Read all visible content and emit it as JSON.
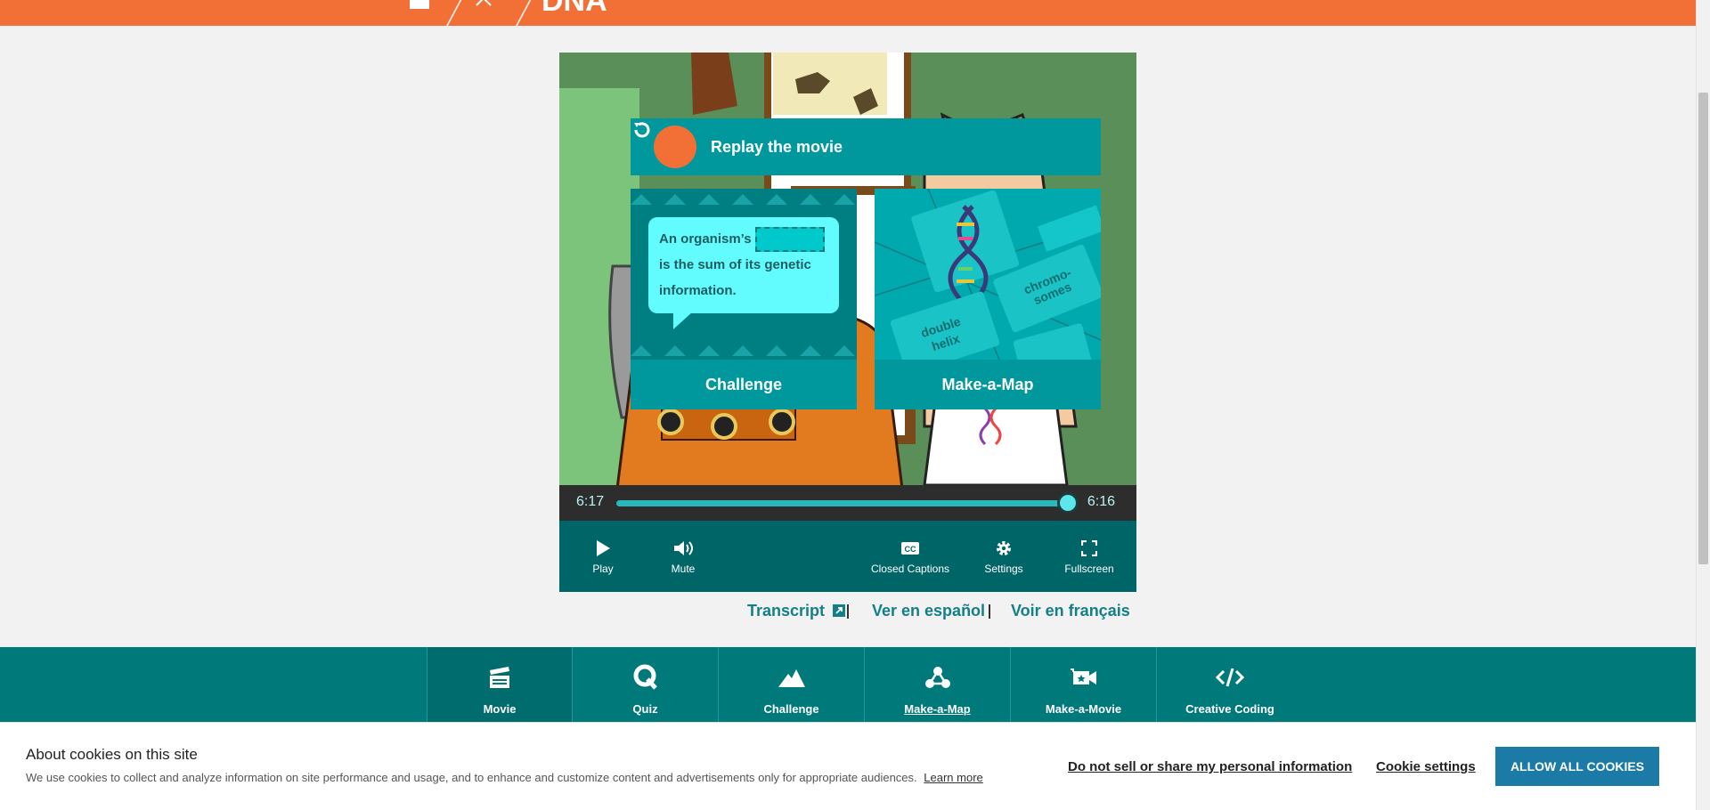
{
  "header": {
    "title": "DNA",
    "bg_color": "#f26f36"
  },
  "player": {
    "replay_label": "Replay the movie",
    "challenge_card": {
      "label": "Challenge",
      "bubble_prefix": "An organism’s",
      "bubble_suffix": "is the sum of its genetic information."
    },
    "map_card": {
      "label": "Make-a-Map",
      "tile_1": "chromo-somes",
      "tile_2": "double helix"
    },
    "time_elapsed": "6:17",
    "time_total": "6:16",
    "progress_percent": 100,
    "controls": [
      {
        "label": "Play",
        "icon": "play-icon"
      },
      {
        "label": "Mute",
        "icon": "volume-icon"
      },
      {
        "label": "Closed Captions",
        "icon": "cc-icon"
      },
      {
        "label": "Settings",
        "icon": "gear-icon"
      },
      {
        "label": "Fullscreen",
        "icon": "fullscreen-icon"
      }
    ]
  },
  "links": {
    "transcript": "Transcript",
    "spanish": "Ver en español",
    "french": "Voir en français"
  },
  "toolnav": {
    "items": [
      {
        "label": "Movie",
        "icon": "clapperboard-icon"
      },
      {
        "label": "Quiz",
        "icon": "q-icon"
      },
      {
        "label": "Challenge",
        "icon": "mountain-icon"
      },
      {
        "label": "Make-a-Map",
        "icon": "nodes-icon"
      },
      {
        "label": "Make-a-Movie",
        "icon": "camera-icon"
      },
      {
        "label": "Creative Coding",
        "icon": "code-icon"
      }
    ]
  },
  "cookie": {
    "title": "About cookies on this site",
    "text": "We use cookies to collect and analyze information on site performance and usage, and to enhance and customize content and advertisements only for appropriate audiences.",
    "learn_more": "Learn more",
    "do_not_sell": "Do not sell or share my personal information",
    "settings": "Cookie settings",
    "allow_all": "ALLOW ALL COOKIES"
  }
}
